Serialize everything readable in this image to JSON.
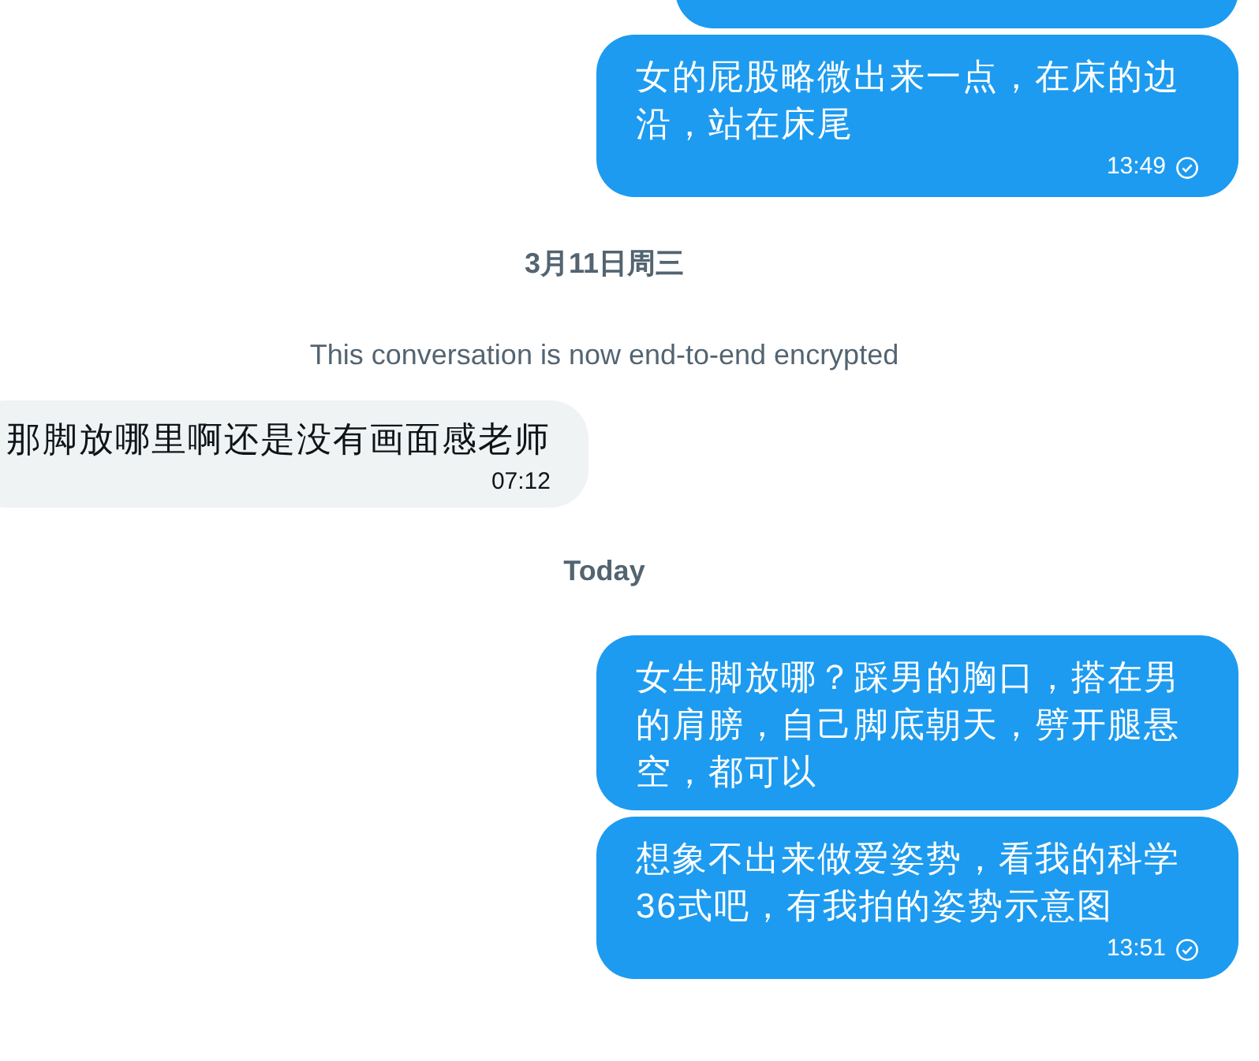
{
  "messages": [
    {
      "kind": "sent",
      "read": false
    },
    {
      "kind": "sent",
      "text": "女的屁股略微出来一点，在床的边沿，站在床尾",
      "time": "13:49",
      "read": true
    },
    {
      "kind": "date",
      "text": "3月11日周三"
    },
    {
      "kind": "notice",
      "text": "This conversation is now end-to-end encrypted"
    },
    {
      "kind": "received",
      "text": "那脚放哪里啊还是没有画面感老师",
      "time": "07:12",
      "read": false
    },
    {
      "kind": "date",
      "text": "Today"
    },
    {
      "kind": "sent",
      "text": "女生脚放哪？踩男的胸口，搭在男的肩膀，自己脚底朝天，劈开腿悬空，都可以",
      "read": false
    },
    {
      "kind": "sent",
      "text": "想象不出来做爱姿势，看我的科学36式吧，有我拍的姿势示意图",
      "time": "13:51",
      "read": true
    }
  ]
}
